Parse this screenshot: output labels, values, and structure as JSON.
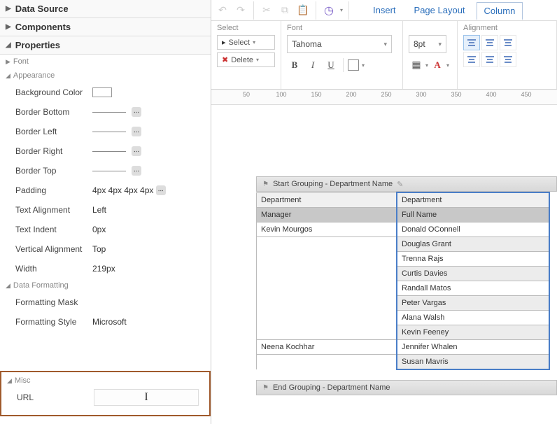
{
  "left": {
    "sections": {
      "data_source": "Data Source",
      "components": "Components",
      "properties": "Properties"
    },
    "groups": {
      "font": "Font",
      "appearance": "Appearance",
      "data_formatting": "Data Formatting",
      "misc": "Misc"
    },
    "appearance": {
      "background_color": {
        "label": "Background Color"
      },
      "border_bottom": {
        "label": "Border Bottom"
      },
      "border_left": {
        "label": "Border Left"
      },
      "border_right": {
        "label": "Border Right"
      },
      "border_top": {
        "label": "Border Top"
      },
      "padding": {
        "label": "Padding",
        "value": "4px 4px 4px 4px"
      },
      "text_alignment": {
        "label": "Text Alignment",
        "value": "Left"
      },
      "text_indent": {
        "label": "Text Indent",
        "value": "0px"
      },
      "vertical_alignment": {
        "label": "Vertical Alignment",
        "value": "Top"
      },
      "width": {
        "label": "Width",
        "value": "219px"
      }
    },
    "data_formatting": {
      "formatting_mask": {
        "label": "Formatting Mask",
        "value": ""
      },
      "formatting_style": {
        "label": "Formatting Style",
        "value": "Microsoft"
      }
    },
    "misc": {
      "url": {
        "label": "URL",
        "value": ""
      }
    }
  },
  "right": {
    "tabs": {
      "insert": "Insert",
      "page_layout": "Page Layout",
      "column": "Column"
    },
    "ribbon": {
      "select": {
        "title": "Select",
        "select_btn": "Select",
        "delete_btn": "Delete"
      },
      "font": {
        "title": "Font",
        "name": "Tahoma",
        "size": "8pt"
      },
      "alignment": {
        "title": "Alignment"
      }
    },
    "ruler_ticks": [
      "50",
      "100",
      "150",
      "200",
      "250",
      "300",
      "350",
      "400",
      "450"
    ],
    "group_start": "Start Grouping - Department Name",
    "group_end": "End Grouping - Department Name",
    "columns": {
      "c1": "Department",
      "c2": "Department"
    },
    "fields": {
      "f1": "Manager",
      "f2": "Full Name"
    },
    "rows": [
      {
        "manager": "Kevin Mourgos",
        "name": "Donald OConnell"
      },
      {
        "manager": "",
        "name": "Douglas Grant"
      },
      {
        "manager": "",
        "name": "Trenna Rajs"
      },
      {
        "manager": "",
        "name": "Curtis Davies"
      },
      {
        "manager": "",
        "name": "Randall Matos"
      },
      {
        "manager": "",
        "name": "Peter Vargas"
      },
      {
        "manager": "",
        "name": "Alana Walsh"
      },
      {
        "manager": "",
        "name": "Kevin Feeney"
      },
      {
        "manager": "Neena Kochhar",
        "name": "Jennifer Whalen"
      },
      {
        "manager": "",
        "name": "Susan Mavris"
      }
    ]
  }
}
